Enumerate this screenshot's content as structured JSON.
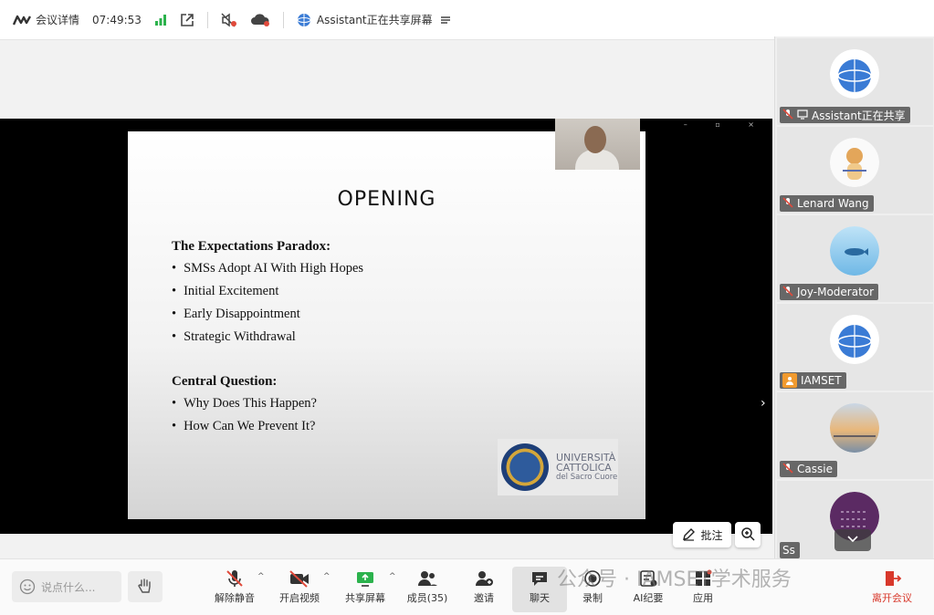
{
  "topbar": {
    "meeting_details": "会议详情",
    "time": "07:49:53",
    "sharing_status": "Assistant正在共享屏幕"
  },
  "slide": {
    "title": "OPENING",
    "section1_heading": "The Expectations Paradox:",
    "section1_items": [
      "SMSs Adopt AI With High Hopes",
      "Initial Excitement",
      "Early Disappointment",
      "Strategic Withdrawal"
    ],
    "section2_heading": "Central Question:",
    "section2_items": [
      "Why Does This Happen?",
      "How Can We Prevent It?"
    ],
    "logo_line1": "UNIVERSITÀ",
    "logo_line2": "CATTOLICA",
    "logo_line3": "del Sacro Cuore"
  },
  "stage": {
    "annotate_label": "批注"
  },
  "participants": [
    {
      "name": "Assistant正在共享"
    },
    {
      "name": "Lenard Wang"
    },
    {
      "name": "Joy-Moderator"
    },
    {
      "name": "IAMSET"
    },
    {
      "name": "Cassie"
    },
    {
      "name": "Ss"
    }
  ],
  "bottombar": {
    "chat_placeholder": "说点什么...",
    "unmute": "解除静音",
    "start_video": "开启视频",
    "share_screen": "共享屏幕",
    "members": "成员(35)",
    "invite": "邀请",
    "chat": "聊天",
    "record": "录制",
    "ai_minutes": "AI纪要",
    "apps": "应用",
    "leave": "离开会议",
    "watermark": "公众号 · IAMSET学术服务"
  },
  "colors": {
    "leave_red": "#d8382b",
    "signal_green": "#2bb24c",
    "muted_red": "#e04a3b"
  }
}
